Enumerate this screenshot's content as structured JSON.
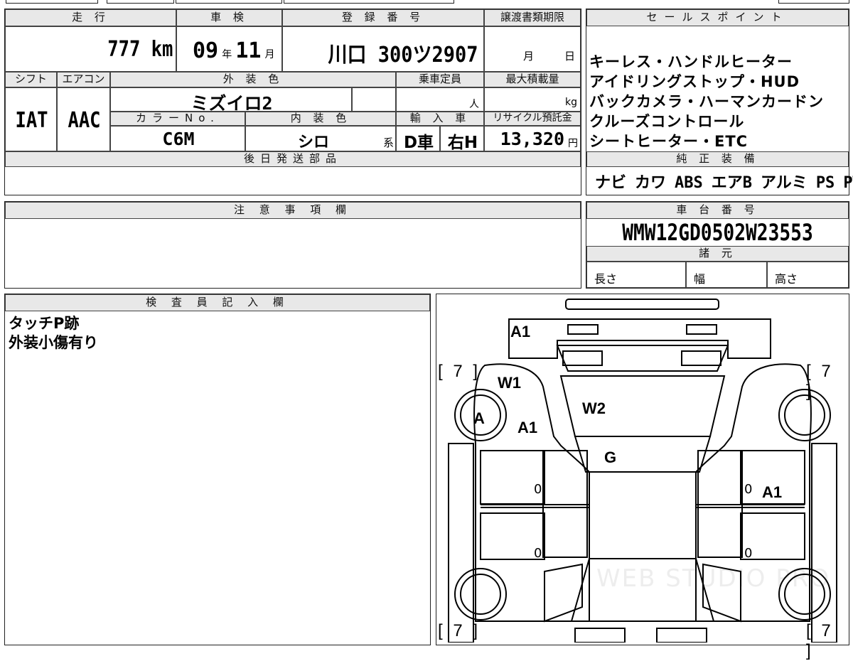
{
  "main": {
    "mileage_label": "走 行",
    "mileage_value": "777 km",
    "shaken_label": "車 検",
    "shaken_year": "09",
    "shaken_year_unit": "年",
    "shaken_month": "11",
    "shaken_month_unit": "月",
    "reg_label": "登 録 番 号",
    "reg_value": "川口 300ツ2907",
    "deadline_label": "譲渡書類期限",
    "deadline_month_unit": "月",
    "deadline_day_unit": "日",
    "shift_label": "シフト",
    "shift_value": "IAT",
    "aircon_label": "エアコン",
    "aircon_value": "AAC",
    "exterior_label": "外 装 色",
    "exterior_value": "ミズイロ2",
    "capacity_label": "乗車定員",
    "capacity_unit": "人",
    "maxload_label": "最大積載量",
    "maxload_unit": "kg",
    "color_no_label": "カラーNo.",
    "color_no_value": "C6M",
    "interior_label": "内 装 色",
    "interior_value": "シロ",
    "interior_suffix": "系",
    "import_label": "輸 入 車",
    "import_value_1": "D車",
    "import_value_2": "右H",
    "recycle_label": "リサイクル預託金",
    "recycle_value": "13,320",
    "recycle_unit": "円",
    "later_parts_label": "後日発送部品"
  },
  "sales_points": {
    "label": "セールスポイント",
    "lines": [
      "キーレス・ハンドルヒーター",
      "アイドリングストップ・HUD",
      "バックカメラ・ハーマンカードン",
      "クルーズコントロール",
      "シートヒーター・ETC"
    ]
  },
  "equipment": {
    "label": "純 正 装 備",
    "items": [
      "ナビ",
      "カワ",
      "ABS",
      "エアB",
      "アルミ",
      "PS",
      "PW"
    ]
  },
  "notes": {
    "label": "注 意 事 項 欄"
  },
  "chassis": {
    "label": "車 台 番 号",
    "value": "WMW12GD0502W23553",
    "specs_label": "諸 元",
    "length_label": "長さ",
    "width_label": "幅",
    "height_label": "高さ"
  },
  "inspector": {
    "label": "検 査 員 記 入 欄",
    "lines": [
      "タッチP跡",
      "外装小傷有り"
    ]
  },
  "diagram": {
    "marks": {
      "a1_top": "A1",
      "w1": "W1",
      "a": "A",
      "a1_left": "A1",
      "w2": "W2",
      "g": "G",
      "a1_right": "A1"
    },
    "brackets": [
      "[ 7 ]",
      "[ 7 ]",
      "[ 7 ]",
      "[ 7 ]"
    ],
    "zeros": [
      "0",
      "0",
      "0",
      "0"
    ],
    "watermark": "WEB STUDIO PRO"
  }
}
